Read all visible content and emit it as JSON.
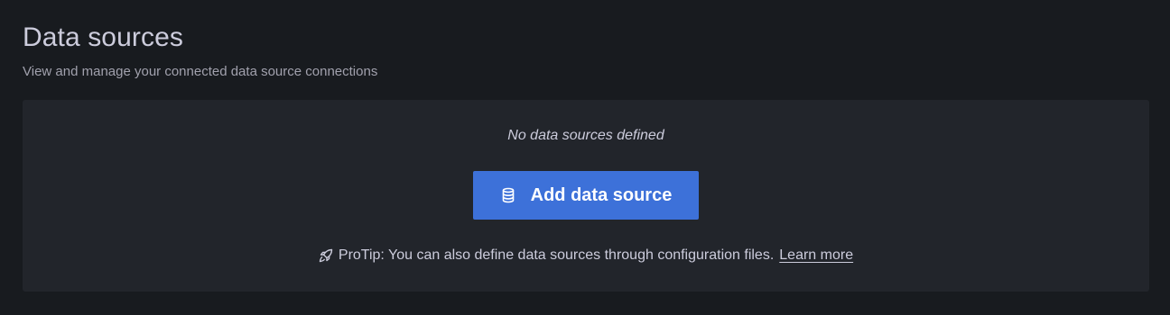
{
  "header": {
    "title": "Data sources",
    "subtitle": "View and manage your connected data source connections"
  },
  "empty_state": {
    "message": "No data sources defined",
    "button_label": "Add data source",
    "button_icon": "database-icon",
    "protip_icon": "rocket-icon",
    "protip_text": "ProTip: You can also define data sources through configuration files.",
    "learn_more_label": "Learn more"
  },
  "colors": {
    "background": "#181b1f",
    "panel": "#22252b",
    "primary_button": "#3d71d9",
    "text": "#ccccdc",
    "secondary_text": "#a1a1ad"
  }
}
